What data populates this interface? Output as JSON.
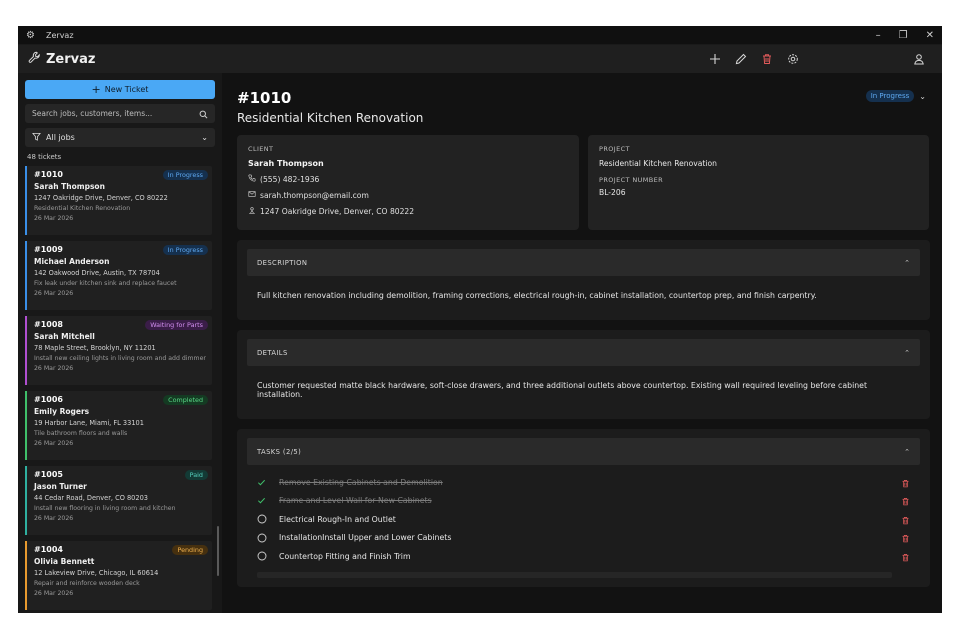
{
  "window": {
    "title": "Zervaz"
  },
  "app": {
    "name": "Zervaz"
  },
  "colors": {
    "accent": "#4aa8f5",
    "trash": "#e05a5a",
    "done": "#3fbf6a"
  },
  "sidebar": {
    "new_ticket_label": "New Ticket",
    "search_placeholder": "Search jobs, customers, items...",
    "filter_label": "All jobs",
    "ticket_count": "48 tickets",
    "tickets": [
      {
        "number": "#1010",
        "name": "Sarah Thompson",
        "address": "1247 Oakridge Drive, Denver, CO 80222",
        "description": "Residential Kitchen Renovation",
        "date": "26 Mar 2026",
        "status": "In Progress",
        "color": "#3a8fe8",
        "badge_bg": "#15304e",
        "badge_fg": "#5ea8f0"
      },
      {
        "number": "#1009",
        "name": "Michael Anderson",
        "address": "142 Oakwood Drive, Austin, TX 78704",
        "description": "Fix leak under kitchen sink and replace faucet",
        "date": "26 Mar 2026",
        "status": "In Progress",
        "color": "#3a8fe8",
        "badge_bg": "#15304e",
        "badge_fg": "#5ea8f0"
      },
      {
        "number": "#1008",
        "name": "Sarah Mitchell",
        "address": "78 Maple Street, Brooklyn, NY 11201",
        "description": "Install new ceiling lights in living room and add dimmer",
        "date": "26 Mar 2026",
        "status": "Waiting for Parts",
        "color": "#b04fd0",
        "badge_bg": "#3a1d48",
        "badge_fg": "#d28ef0"
      },
      {
        "number": "#1006",
        "name": "Emily Rogers",
        "address": "19 Harbor Lane, Miami, FL 33101",
        "description": "Tile bathroom floors and walls",
        "date": "26 Mar 2026",
        "status": "Completed",
        "color": "#3fbf6a",
        "badge_bg": "#143a22",
        "badge_fg": "#58d685"
      },
      {
        "number": "#1005",
        "name": "Jason Turner",
        "address": "44 Cedar Road, Denver, CO 80203",
        "description": "Install new flooring in living room and kitchen",
        "date": "26 Mar 2026",
        "status": "Paid",
        "color": "#2fb0a0",
        "badge_bg": "#133a35",
        "badge_fg": "#55d0bd"
      },
      {
        "number": "#1004",
        "name": "Olivia Bennett",
        "address": "12 Lakeview Drive, Chicago, IL 60614",
        "description": "Repair and reinforce wooden deck",
        "date": "26 Mar 2026",
        "status": "Pending",
        "color": "#e89a2f",
        "badge_bg": "#46300f",
        "badge_fg": "#f0b14e"
      }
    ]
  },
  "detail": {
    "number": "#1010",
    "title": "Residential Kitchen Renovation",
    "status": "In Progress",
    "client": {
      "label": "CLIENT",
      "name": "Sarah Thompson",
      "phone": "(555) 482-1936",
      "email": "sarah.thompson@email.com",
      "address": "1247 Oakridge Drive, Denver, CO 80222"
    },
    "project": {
      "label": "PROJECT",
      "name": "Residential Kitchen Renovation",
      "number_label": "PROJECT NUMBER",
      "number": "BL-206"
    },
    "description": {
      "label": "DESCRIPTION",
      "text": "Full kitchen renovation including demolition, framing corrections, electrical rough-in, cabinet installation, countertop prep, and finish carpentry."
    },
    "details": {
      "label": "DETAILS",
      "text": "Customer requested matte black hardware, soft-close drawers, and three additional outlets above countertop. Existing wall required leveling before cabinet installation."
    },
    "tasks": {
      "label": "TASKS (2/5)",
      "items": [
        {
          "text": "Remove Existing Cabinets and Demolition",
          "done": true
        },
        {
          "text": "Frame and Level Wall for New Cabinets",
          "done": true
        },
        {
          "text": "Electrical Rough-In and Outlet",
          "done": false
        },
        {
          "text": "InstallationInstall Upper and Lower Cabinets",
          "done": false
        },
        {
          "text": "Countertop Fitting and Finish Trim",
          "done": false
        }
      ]
    }
  }
}
